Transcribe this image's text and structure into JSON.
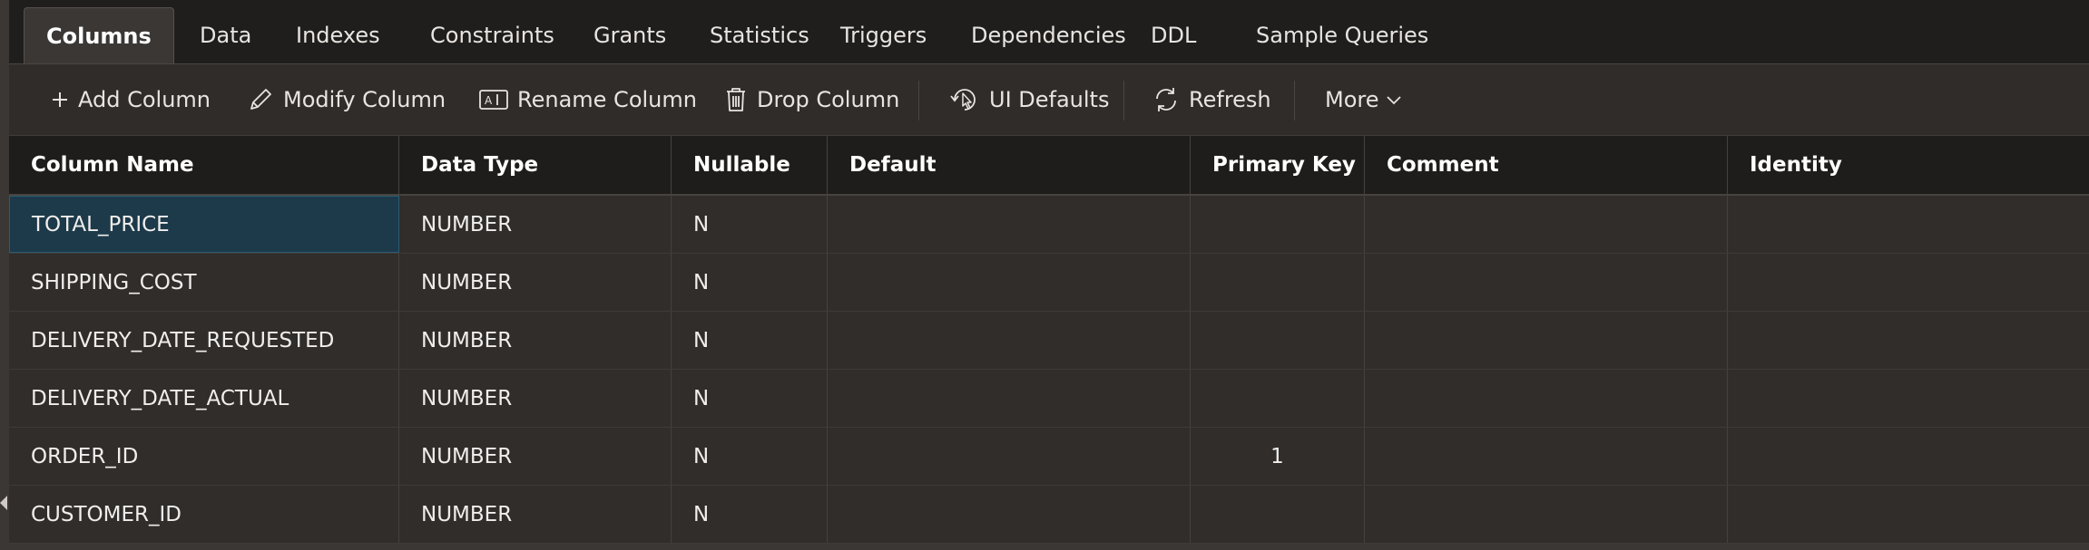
{
  "tabs": [
    {
      "label": "Columns",
      "active": true
    },
    {
      "label": "Data"
    },
    {
      "label": "Indexes"
    },
    {
      "label": "Constraints"
    },
    {
      "label": "Grants"
    },
    {
      "label": "Statistics"
    },
    {
      "label": "Triggers"
    },
    {
      "label": "Dependencies"
    },
    {
      "label": "DDL"
    },
    {
      "label": "Sample Queries"
    }
  ],
  "toolbar": {
    "add_column": "Add Column",
    "modify_column": "Modify Column",
    "rename_column": "Rename Column",
    "drop_column": "Drop Column",
    "ui_defaults": "UI Defaults",
    "refresh": "Refresh",
    "more": "More"
  },
  "table": {
    "headers": [
      "Column Name",
      "Data Type",
      "Nullable",
      "Default",
      "Primary Key",
      "Comment",
      "Identity"
    ],
    "rows": [
      [
        "TOTAL_PRICE",
        "NUMBER",
        "N",
        "",
        "",
        "",
        ""
      ],
      [
        "SHIPPING_COST",
        "NUMBER",
        "N",
        "",
        "",
        "",
        ""
      ],
      [
        "DELIVERY_DATE_REQUESTED",
        "NUMBER",
        "N",
        "",
        "",
        "",
        ""
      ],
      [
        "DELIVERY_DATE_ACTUAL",
        "NUMBER",
        "N",
        "",
        "",
        "",
        ""
      ],
      [
        "ORDER_ID",
        "NUMBER",
        "N",
        "",
        "1",
        "",
        ""
      ],
      [
        "CUSTOMER_ID",
        "NUMBER",
        "N",
        "",
        "",
        "",
        ""
      ]
    ]
  },
  "colors": {
    "selection": "#1c3a4a",
    "background": "#2b2927",
    "header": "#1f1d1b"
  }
}
